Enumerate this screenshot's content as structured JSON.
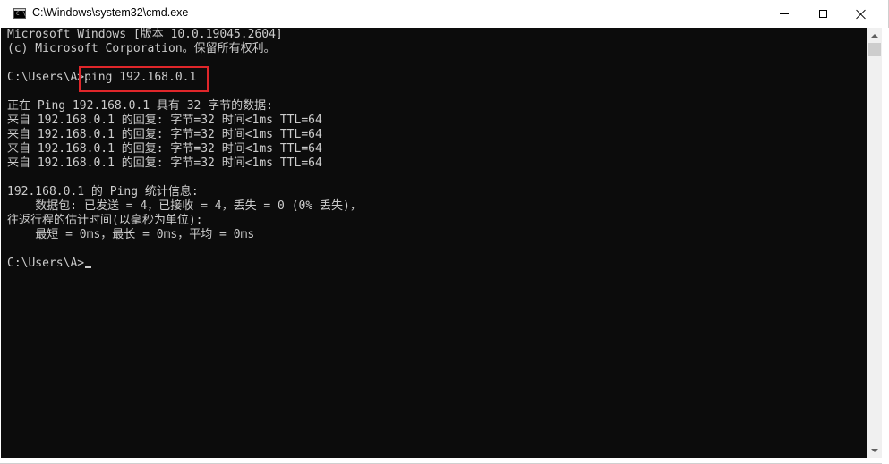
{
  "window": {
    "title": "C:\\Windows\\system32\\cmd.exe",
    "app_icon_text": "C:\\"
  },
  "console": {
    "lines": [
      "Microsoft Windows [版本 10.0.19045.2604]",
      "(c) Microsoft Corporation。保留所有权利。",
      "",
      "C:\\Users\\A>ping 192.168.0.1",
      "",
      "正在 Ping 192.168.0.1 具有 32 字节的数据:",
      "来自 192.168.0.1 的回复: 字节=32 时间<1ms TTL=64",
      "来自 192.168.0.1 的回复: 字节=32 时间<1ms TTL=64",
      "来自 192.168.0.1 的回复: 字节=32 时间<1ms TTL=64",
      "来自 192.168.0.1 的回复: 字节=32 时间<1ms TTL=64",
      "",
      "192.168.0.1 的 Ping 统计信息:",
      "    数据包: 已发送 = 4，已接收 = 4，丢失 = 0 (0% 丢失)，",
      "往返行程的估计时间(以毫秒为单位):",
      "    最短 = 0ms，最长 = 0ms，平均 = 0ms",
      "",
      "C:\\Users\\A>"
    ],
    "highlighted_command": "ping 192.168.0.1"
  },
  "colors": {
    "console_background": "#0c0c0c",
    "console_text": "#cccccc",
    "highlight_border": "#e0262a"
  },
  "icons": {
    "minimize": "minimize-icon",
    "maximize": "maximize-icon",
    "close": "close-icon"
  }
}
